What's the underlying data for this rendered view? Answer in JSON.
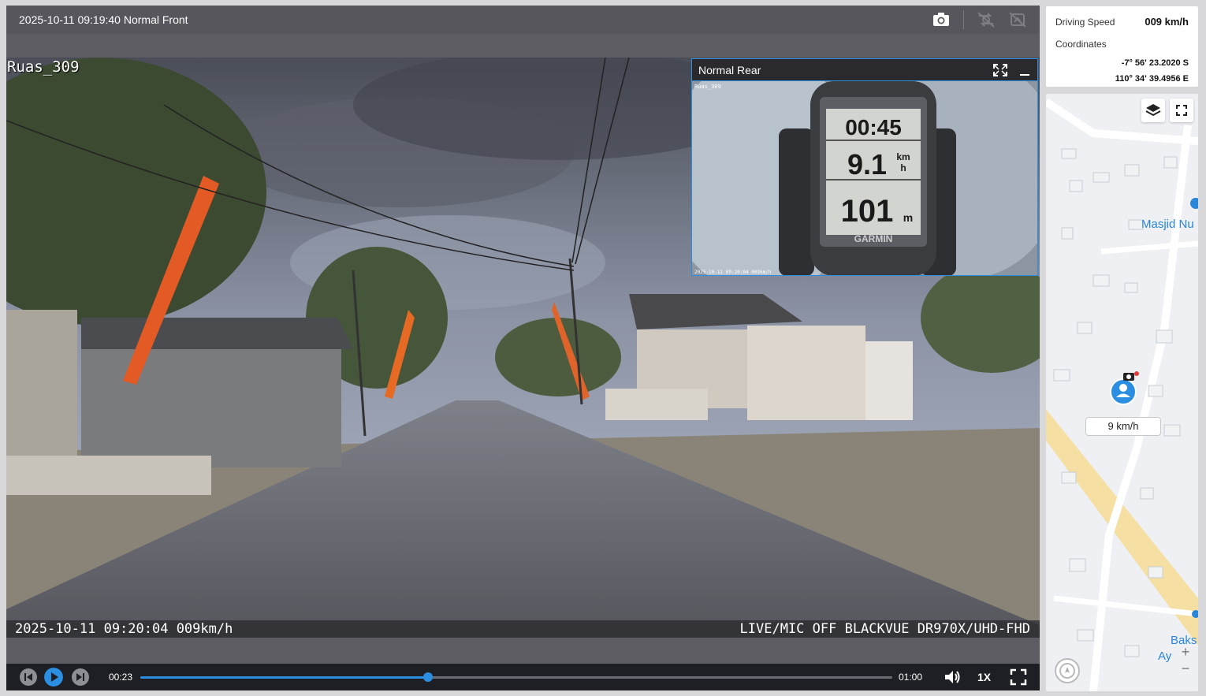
{
  "player": {
    "title": "2025-10-11 09:19:40 Normal Front",
    "snapshot_icon": "camera-icon",
    "overlay_top_left": "Ruas_309",
    "osd_left": "2025-10-11 09:20:04 009km/h",
    "osd_right": "LIVE/MIC OFF BLACKVUE DR970X/UHD-FHD",
    "pip": {
      "title": "Normal Rear",
      "gps_timer": "00:45",
      "gps_speed": "9.1",
      "gps_speed_unit_top": "km",
      "gps_speed_unit_bottom": "h",
      "gps_distance": "101",
      "gps_distance_unit": "m",
      "gps_brand": "GARMIN",
      "tiny_osd_left": "Ruas_309",
      "tiny_osd_bottom": "2025-10-11 09:20:04 009km/h"
    },
    "controls": {
      "current_time": "00:23",
      "total_time": "01:00",
      "progress": 0.383,
      "playback_speed": "1X"
    }
  },
  "info_panel": {
    "speed_label": "Driving Speed",
    "speed_value": "009 km/h",
    "coordinates_label": "Coordinates",
    "latitude": "-7° 56' 23.2020 S",
    "longitude": "110° 34' 39.4956 E"
  },
  "map": {
    "speed_marker": "9 km/h",
    "poi_1": "Masjid Nu",
    "poi_2": "Baks",
    "poi_3": "Ay",
    "zoom_in": "+",
    "zoom_out": "−"
  },
  "colors": {
    "accent": "#2b8ee0",
    "toolbar": "#56565c",
    "controlbar": "#1e1f24"
  }
}
